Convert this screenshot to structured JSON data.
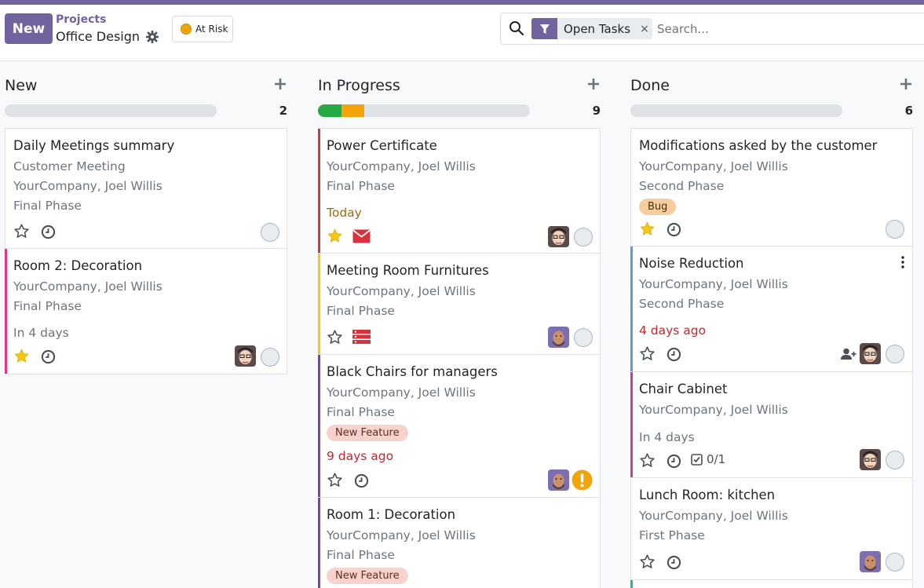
{
  "header": {
    "new_label": "New",
    "breadcrumb_parent": "Projects",
    "breadcrumb_current": "Office Design",
    "status_label": "At Risk",
    "status_color": "#f3a40b"
  },
  "search": {
    "facet_label": "Open Tasks",
    "facet_remove": "×",
    "placeholder": "Search..."
  },
  "colors": {
    "brand": "#71639e",
    "tag_new_feature_bg": "#f8d3cd",
    "tag_bug_bg": "#f7cd9f",
    "overdue": "#c6262e",
    "today": "#9a6b12",
    "star": "#f5c518"
  },
  "columns": [
    {
      "title": "New",
      "count": "2",
      "cards": [
        {
          "title": "Daily Meetings summary",
          "lines": [
            "Customer Meeting",
            "YourCompany, Joel Willis",
            "Final Phase"
          ],
          "starred": false
        },
        {
          "title": "Room 2: Decoration",
          "lines": [
            "YourCompany, Joel Willis",
            "Final Phase"
          ],
          "deadline": "In 4 days",
          "starred": true
        }
      ]
    },
    {
      "title": "In Progress",
      "count": "9",
      "progress": [
        {
          "color": "#28a745",
          "fraction": 0.11
        },
        {
          "color": "#f3a40b",
          "fraction": 0.11
        }
      ],
      "cards": [
        {
          "title": "Power Certificate",
          "lines": [
            "YourCompany, Joel Willis",
            "Final Phase"
          ],
          "deadline": "Today",
          "starred": true
        },
        {
          "title": "Meeting Room Furnitures",
          "lines": [
            "YourCompany, Joel Willis",
            "Final Phase"
          ],
          "starred": false
        },
        {
          "title": "Black Chairs for managers",
          "lines": [
            "YourCompany, Joel Willis",
            "Final Phase"
          ],
          "tag": "New Feature",
          "deadline": "9 days ago",
          "starred": false
        },
        {
          "title": "Room 1: Decoration",
          "lines": [
            "YourCompany, Joel Willis",
            "Final Phase"
          ],
          "tag": "New Feature"
        }
      ]
    },
    {
      "title": "Done",
      "count": "6",
      "cards": [
        {
          "title": "Modifications asked by the customer",
          "lines": [
            "YourCompany, Joel Willis",
            "Second Phase"
          ],
          "tag": "Bug",
          "starred": true
        },
        {
          "title": "Noise Reduction",
          "lines": [
            "YourCompany, Joel Willis",
            "Second Phase"
          ],
          "deadline": "4 days ago",
          "starred": false
        },
        {
          "title": "Chair Cabinet",
          "lines": [
            "YourCompany, Joel Willis"
          ],
          "deadline": "In 4 days",
          "subtasks": "0/1",
          "starred": false
        },
        {
          "title": "Lunch Room: kitchen",
          "lines": [
            "YourCompany, Joel Willis",
            "First Phase"
          ],
          "starred": false
        }
      ]
    }
  ]
}
